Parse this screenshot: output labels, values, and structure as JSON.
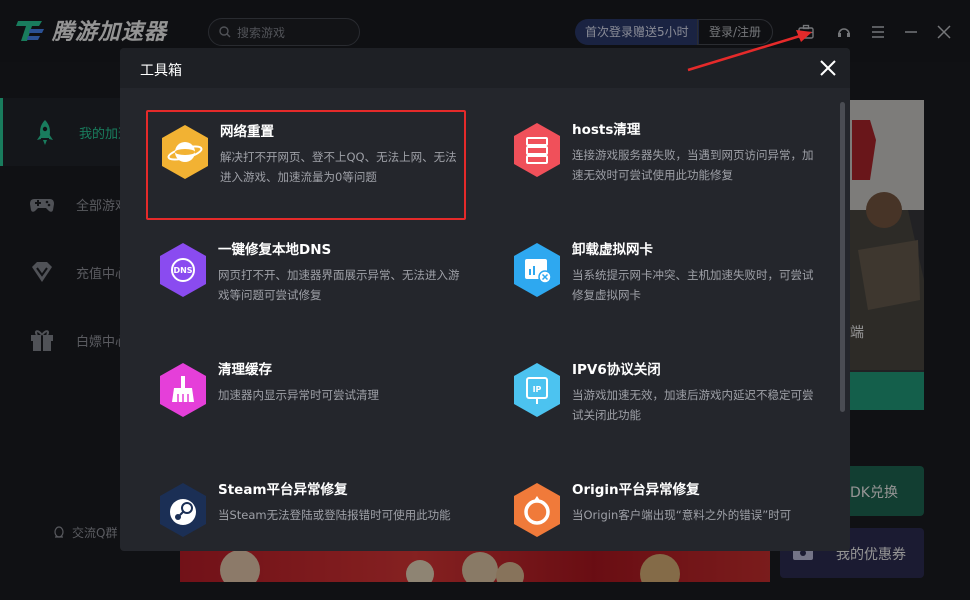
{
  "app": {
    "title": "腾游加速器",
    "search_placeholder": "搜索游戏",
    "promo": "首次登录赠送5小时",
    "login": "登录/注册"
  },
  "sidebar": {
    "items": [
      {
        "label": "我的加速",
        "icon": "rocket-icon"
      },
      {
        "label": "全部游戏",
        "icon": "gamepad-icon"
      },
      {
        "label": "充值中心",
        "icon": "diamond-icon"
      },
      {
        "label": "白嫖中心",
        "icon": "gift-icon"
      }
    ],
    "qq_group": "交流Q群"
  },
  "background": {
    "cdk_label": "DK兑换",
    "coupon_label": "我的优惠券",
    "card_fragment": "端"
  },
  "modal": {
    "title": "工具箱",
    "tools": [
      {
        "name": "网络重置",
        "desc": "解决打不开网页、登不上QQ、无法上网、无法进入游戏、加速流量为0等问题",
        "icon": "planet-icon",
        "color": "#f2b233"
      },
      {
        "name": "hosts清理",
        "desc": "连接游戏服务器失败，当遇到网页访问异常，加速无效时可尝试使用此功能修复",
        "icon": "server-icon",
        "color": "#f0505a"
      },
      {
        "name": "一键修复本地DNS",
        "desc": "网页打不开、加速器界面展示异常、无法进入游戏等问题可尝试修复",
        "icon": "dns-icon",
        "color": "#8a4bf0"
      },
      {
        "name": "卸载虚拟网卡",
        "desc": "当系统提示网卡冲突、主机加速失败时，可尝试修复虚拟网卡",
        "icon": "network-card-icon",
        "color": "#2ea8f0"
      },
      {
        "name": "清理缓存",
        "desc": "加速器内显示异常时可尝试清理",
        "icon": "broom-icon",
        "color": "#e53fd9"
      },
      {
        "name": "IPV6协议关闭",
        "desc": "当游戏加速无效，加速后游戏内延迟不稳定可尝试关闭此功能",
        "icon": "ip-icon",
        "color": "#4cc3f0"
      },
      {
        "name": "Steam平台异常修复",
        "desc": "当Steam无法登陆或登陆报错时可使用此功能",
        "icon": "steam-icon",
        "color": "#1b2f55"
      },
      {
        "name": "Origin平台异常修复",
        "desc": "当Origin客户端出现“意料之外的错误”时可",
        "icon": "origin-icon",
        "color": "#f07a3a"
      }
    ]
  }
}
